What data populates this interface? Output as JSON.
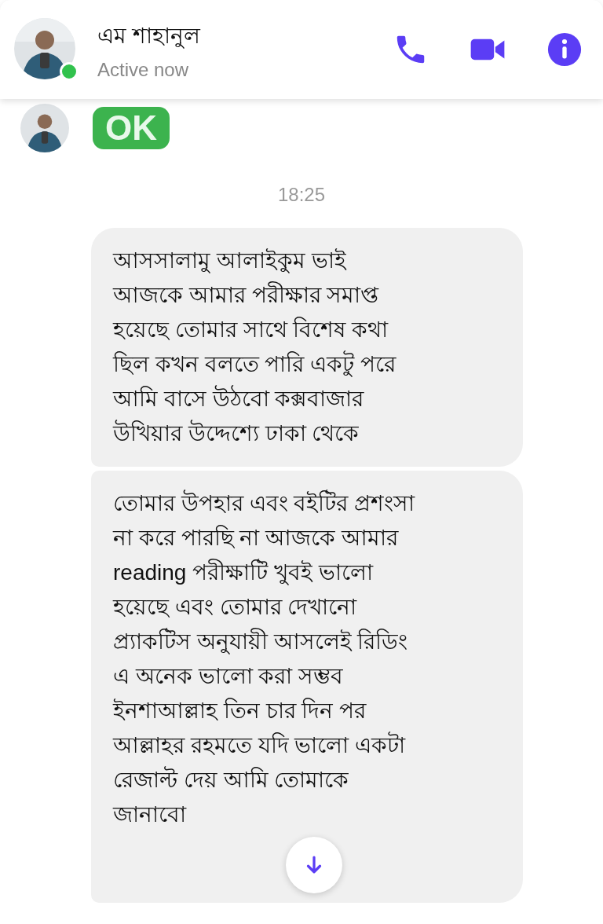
{
  "header": {
    "name": "এম শাহানুল",
    "status": "Active now",
    "active": true
  },
  "sticker": {
    "text": "OK"
  },
  "timestamp": "18:25",
  "messages": [
    {
      "text": "আসসালামু আলাইকুম ভাই\nআজকে আমার পরীক্ষার সমাপ্ত\nহয়েছে তোমার সাথে বিশেষ কথা\nছিল কখন বলতে পারি একটু পরে\nআমি বাসে উঠবো কক্সবাজার\nউখিয়ার উদ্দেশ্যে ঢাকা থেকে"
    },
    {
      "text": "তোমার উপহার এবং বইটির প্রশংসা\nনা করে পারছি না আজকে আমার\nreading পরীক্ষাটি খুবই ভালো\nহয়েছে এবং তোমার দেখানো\nপ্র্যাকটিস অনুযায়ী আসলেই রিডিং\nএ অনেক ভালো করা সম্ভব\nইনশাআল্লাহ তিন চার দিন পর\nআল্লাহর রহমতে যদি ভালো একটা\nরেজাল্ট দেয় আমি তোমাকে\nজানাবো"
    }
  ]
}
